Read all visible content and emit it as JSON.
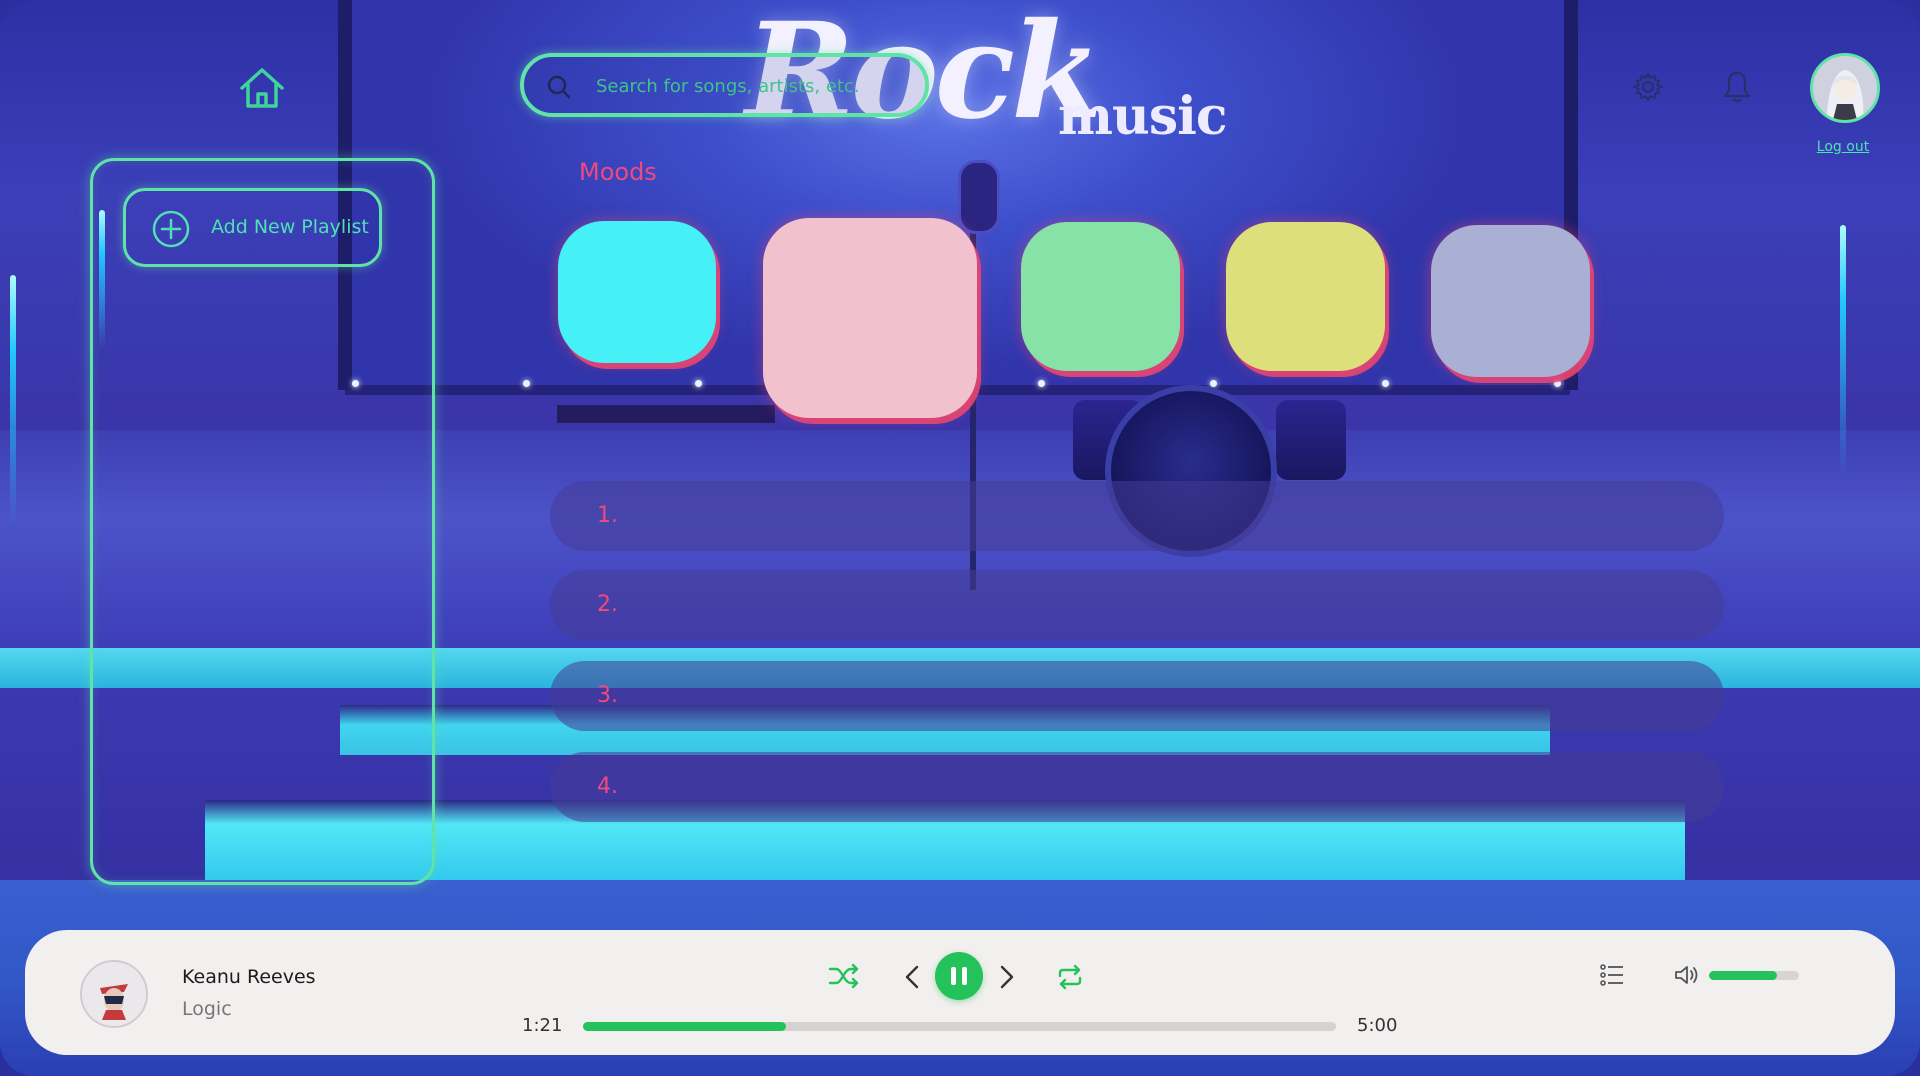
{
  "logo": {
    "line1": "Rock",
    "line2": "music"
  },
  "header": {
    "search_placeholder": "Search for songs, artists, etc.",
    "logout_label": "Log out"
  },
  "sidebar": {
    "add_playlist_label": "Add New Playlist"
  },
  "moods": {
    "title": "Moods",
    "tiles": [
      {
        "color": "#45f0f6"
      },
      {
        "color": "#f1c2ce"
      },
      {
        "color": "#86e2a6"
      },
      {
        "color": "#dde07a"
      },
      {
        "color": "#a9b0d4"
      }
    ]
  },
  "list": {
    "rows": [
      {
        "number": "1."
      },
      {
        "number": "2."
      },
      {
        "number": "3."
      },
      {
        "number": "4."
      }
    ]
  },
  "player": {
    "artist": "Keanu Reeves",
    "track": "Logic",
    "elapsed": "1:21",
    "duration": "5:00",
    "progress_fraction": 0.27,
    "volume_fraction": 0.75
  },
  "colors": {
    "accent_green": "#23c25a",
    "neon_green": "#5fe3a6",
    "mood_pink": "#f04a7c"
  },
  "icons": {
    "home": "home-icon",
    "search": "search-icon",
    "settings": "gear-icon",
    "notifications": "bell-icon",
    "add": "plus-circle-icon",
    "shuffle": "shuffle-icon",
    "previous": "chevron-left-icon",
    "pause": "pause-icon",
    "next": "chevron-right-icon",
    "repeat": "repeat-icon",
    "queue": "queue-list-icon",
    "volume": "volume-icon"
  }
}
